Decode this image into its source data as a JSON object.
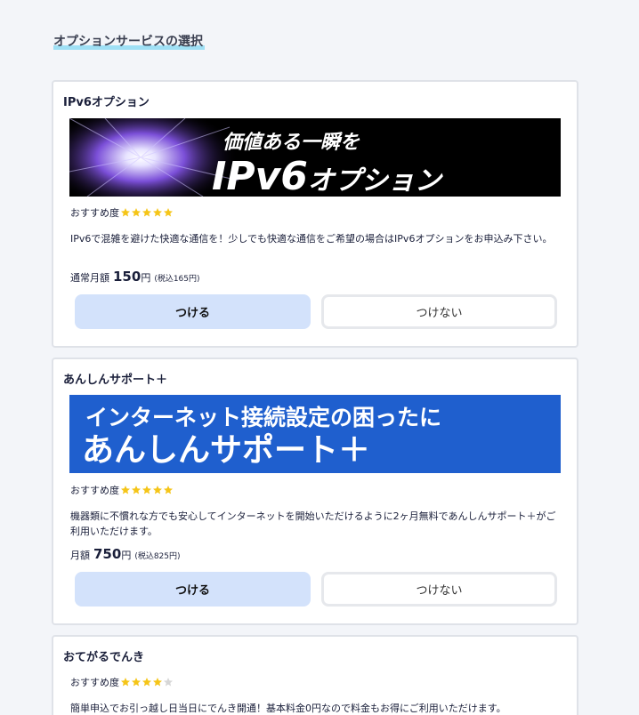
{
  "page": {
    "section_title": "オプションサービスの選択"
  },
  "cards": [
    {
      "title": "IPv6オプション",
      "banner": {
        "line1": "価値ある一瞬を",
        "line2_a": "IPv6",
        "line2_b": "オプション",
        "bg": "#000000"
      },
      "recommend_label": "おすすめ度",
      "stars_filled": 5,
      "stars_total": 5,
      "description": "IPv6で混雑を避けた快適な通信を！少しでも快適な通信をご希望の場合はIPv6オプションをお申込み下さい。",
      "price_label": "通常月額",
      "price_value": "150",
      "price_unit": "円",
      "price_tax": "(税込165円)",
      "btn_add": "つける",
      "btn_skip": "つけない"
    },
    {
      "title": "あんしんサポート＋",
      "banner": {
        "line1": "インターネット接続設定の困ったに",
        "line2": "あんしんサポート＋",
        "bg": "#1f5fce"
      },
      "recommend_label": "おすすめ度",
      "stars_filled": 5,
      "stars_total": 5,
      "description": "機器類に不慣れな方でも安心してインターネットを開始いただけるように2ヶ月無料であんしんサポート＋がご利用いただけます。",
      "price_label": "月額",
      "price_value": "750",
      "price_unit": "円",
      "price_tax": "(税込825円)",
      "btn_add": "つける",
      "btn_skip": "つけない"
    },
    {
      "title": "おてがるでんき",
      "recommend_label": "おすすめ度",
      "stars_filled": 4,
      "stars_total": 5,
      "description": "簡単申込でお引っ越し日当日にでんき開通！基本料金0円なので料金もお得にご利用いただけます。"
    }
  ],
  "colors": {
    "star_on": "#f5c518",
    "star_off": "#d6d6d6",
    "selected_btn": "#d3e2fb",
    "highlight": "#9fe0f5"
  }
}
